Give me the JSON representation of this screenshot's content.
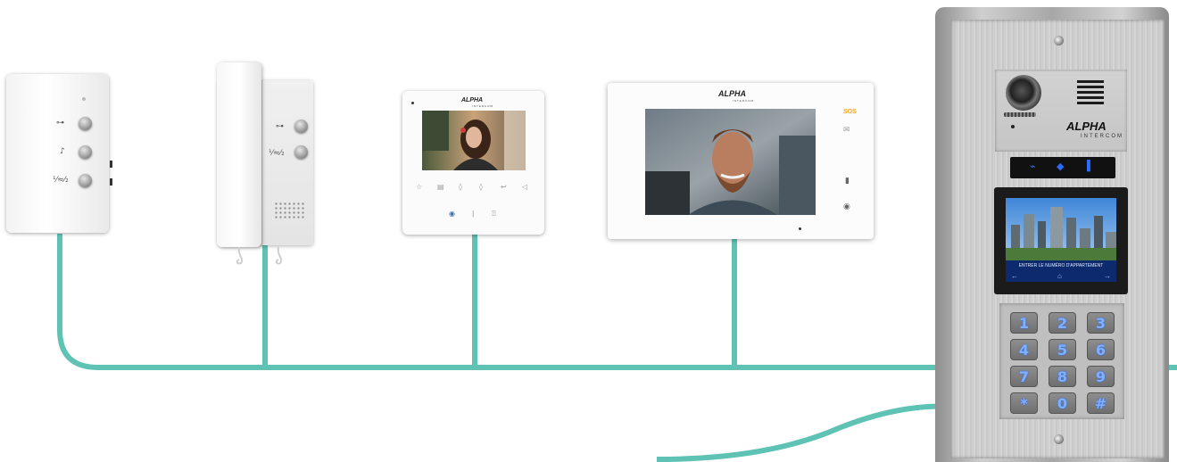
{
  "devices": {
    "audio_unit": {
      "buttons": [
        {
          "icon": "key-icon",
          "glyph": "⊶"
        },
        {
          "icon": "bell-icon",
          "glyph": "♪"
        },
        {
          "icon": "call-icon",
          "glyph": "⅟≈⁄₂"
        }
      ]
    },
    "handset": {
      "buttons": [
        {
          "icon": "key-icon",
          "glyph": "⊶"
        },
        {
          "icon": "call-icon",
          "glyph": "⅟≈⁄₂"
        }
      ]
    },
    "monitor_small": {
      "brand": "ALPHA",
      "brand_sub": "INTERCOM",
      "icons": [
        "☆",
        "▤",
        "◊",
        "◊",
        "↩",
        "◁"
      ],
      "bottom_icons": [
        "◉",
        "ǀ",
        "⍐"
      ]
    },
    "monitor_large": {
      "brand": "ALPHA",
      "brand_sub": "INTERCOM",
      "sos": "SOS",
      "side_icons": [
        "✉",
        "▮",
        "◉"
      ]
    },
    "door_panel": {
      "brand": "ALPHA",
      "brand_sub": "INTERCOM",
      "strip_icons": [
        "⌁",
        "◆",
        "▐"
      ],
      "lcd_text": "ENTRER LE NUMÉRO D'APPARTEMENT",
      "lcd_nav": [
        "←",
        "⌂",
        "→"
      ],
      "keys": [
        "1",
        "2",
        "3",
        "4",
        "5",
        "6",
        "7",
        "8",
        "9",
        "*",
        "0",
        "#"
      ]
    }
  },
  "colors": {
    "wire": "#5ec2b4",
    "panel_key_text": "#7fb0ff",
    "sos": "#f5a623"
  }
}
